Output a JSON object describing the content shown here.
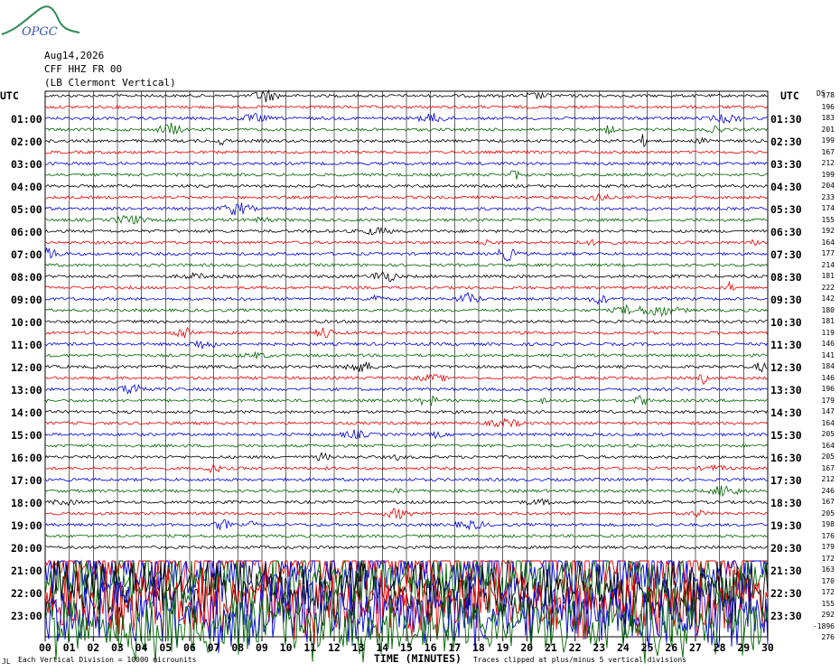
{
  "header": {
    "logo_text": "OPGC",
    "date": "Aug14,2026",
    "channel": "CFF HHZ FR 00",
    "station": "(LB Clermont Vertical)",
    "utc_left": "UTC",
    "utc_right": "UTC",
    "ds_label": "DS"
  },
  "left_times": [
    "01:00",
    "02:00",
    "03:00",
    "04:00",
    "05:00",
    "06:00",
    "07:00",
    "08:00",
    "09:00",
    "10:00",
    "11:00",
    "12:00",
    "13:00",
    "14:00",
    "15:00",
    "16:00",
    "17:00",
    "18:00",
    "19:00",
    "20:00",
    "21:00",
    "22:00",
    "23:00"
  ],
  "right_times": [
    "01:30",
    "02:30",
    "03:30",
    "04:30",
    "05:30",
    "06:30",
    "07:30",
    "08:30",
    "09:30",
    "10:30",
    "11:30",
    "12:30",
    "13:30",
    "14:30",
    "15:30",
    "16:30",
    "17:30",
    "18:30",
    "19:30",
    "20:30",
    "21:30",
    "22:30",
    "23:30"
  ],
  "rms_values": [
    "178",
    "196",
    "183",
    "201",
    "199",
    "167",
    "212",
    "199",
    "204",
    "233",
    "174",
    "155",
    "192",
    "164",
    "177",
    "214",
    "181",
    "222",
    "142",
    "180",
    "181",
    "119",
    "146",
    "141",
    "184",
    "146",
    "196",
    "179",
    "147",
    "164",
    "205",
    "164",
    "205",
    "167",
    "212",
    "246",
    "167",
    "205",
    "198",
    "176",
    "179",
    "172",
    "163",
    "170",
    "172",
    "155",
    "292",
    "-1896",
    "276"
  ],
  "x_ticks": [
    "00",
    "01",
    "02",
    "03",
    "04",
    "05",
    "06",
    "07",
    "08",
    "09",
    "10",
    "11",
    "12",
    "13",
    "14",
    "15",
    "16",
    "17",
    "18",
    "19",
    "20",
    "21",
    "22",
    "23",
    "24",
    "25",
    "26",
    "27",
    "28",
    "29",
    "30"
  ],
  "x_label": "TIME (MINUTES)",
  "footer": {
    "left_mark": "JL",
    "scale_note": "Each Vertical Division = 10000 microunits",
    "clip_note": "Traces clipped at plus/minus 5 vertical divisions"
  },
  "colors": {
    "trace_cycle": [
      "#000000",
      "#ee0000",
      "#0000dd",
      "#006600"
    ],
    "grid": "#000000",
    "logo": "#2e8b57",
    "logo_text": "#3355aa"
  },
  "plot_meta": {
    "traces": 48,
    "minutes_per_trace": 30,
    "noisy_from_trace": 41
  }
}
